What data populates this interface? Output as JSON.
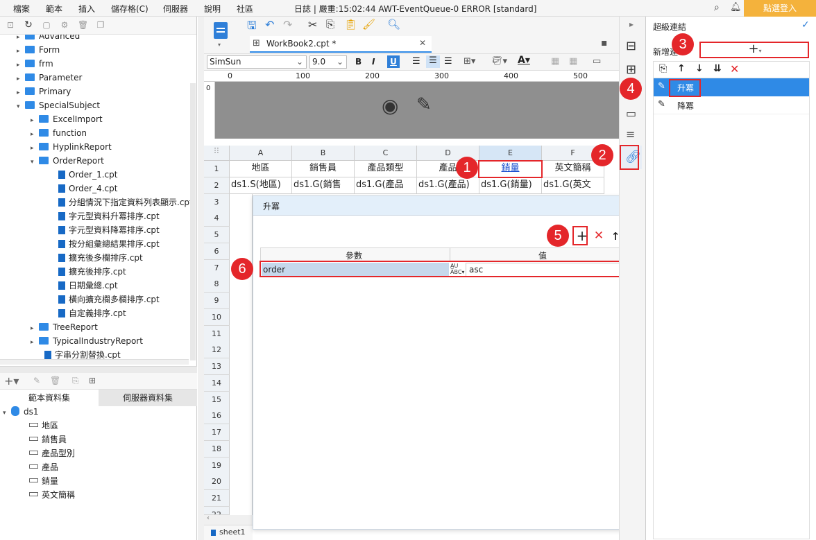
{
  "menubar": {
    "items": [
      "檔案",
      "範本",
      "插入",
      "儲存格(C)",
      "伺服器",
      "說明",
      "社區"
    ],
    "log": "日誌 | 嚴重:15:02:44 AWT-EventQueue-0 ERROR [standard]",
    "login": "點選登入"
  },
  "tree": {
    "items": [
      {
        "label": "Advanced"
      },
      {
        "label": "Form"
      },
      {
        "label": "frm"
      },
      {
        "label": "Parameter"
      },
      {
        "label": "Primary"
      },
      {
        "label": "SpecialSubject"
      },
      {
        "label": "ExcelImport"
      },
      {
        "label": "function"
      },
      {
        "label": "HyplinkReport"
      },
      {
        "label": "OrderReport"
      },
      {
        "label": "Order_1.cpt"
      },
      {
        "label": "Order_4.cpt"
      },
      {
        "label": "分組情況下指定資料列表顯示.cpt"
      },
      {
        "label": "字元型資料升冪排序.cpt"
      },
      {
        "label": "字元型資料降冪排序.cpt"
      },
      {
        "label": "按分組彙總結果排序.cpt"
      },
      {
        "label": "擴充後多欄排序.cpt"
      },
      {
        "label": "擴充後排序.cpt"
      },
      {
        "label": "日期彙總.cpt"
      },
      {
        "label": "橫向擴充欄多欄排序.cpt"
      },
      {
        "label": "自定義排序.cpt"
      },
      {
        "label": "TreeReport"
      },
      {
        "label": "TypicalIndustryReport"
      },
      {
        "label": "字串分割替換.cpt"
      }
    ]
  },
  "dataset_tabs": [
    "範本資料集",
    "伺服器資料集"
  ],
  "dataset": {
    "name": "ds1",
    "fields": [
      "地區",
      "銷售員",
      "產品型別",
      "產品",
      "銷量",
      "英文簡稱"
    ]
  },
  "editor": {
    "tab": "WorkBook2.cpt *",
    "font": "SimSun",
    "font_size": "9.0",
    "ruler": [
      "0",
      "100",
      "200",
      "300",
      "400",
      "500"
    ],
    "ruler_left": "0",
    "columns": [
      "A",
      "B",
      "C",
      "D",
      "E",
      "F"
    ],
    "rows": [
      "1",
      "2",
      "3",
      "4",
      "5",
      "6",
      "7",
      "8",
      "9",
      "10",
      "11",
      "12",
      "13",
      "14",
      "15",
      "16",
      "17",
      "18",
      "19",
      "20",
      "21",
      "22"
    ],
    "row1": [
      "地區",
      "銷售員",
      "產品類型",
      "產品",
      "銷量",
      "英文簡稱"
    ],
    "row2": [
      "ds1.S(地區)",
      "ds1.G(銷售",
      "ds1.G(產品",
      "ds1.G(產品)",
      "ds1.G(銷量)",
      "ds1.G(英文"
    ],
    "sheet": "sheet1"
  },
  "dialog": {
    "title": "升冪",
    "col_param": "參數",
    "col_value": "值",
    "param": "order",
    "value": "asc"
  },
  "right_panel": {
    "title": "超級連結",
    "new_label": "新增連",
    "items": [
      "升冪",
      "降冪"
    ]
  },
  "badges": [
    "1",
    "2",
    "3",
    "4",
    "5",
    "6"
  ],
  "colors": {
    "accent": "#e4262a",
    "selection": "#2f8ae6",
    "login": "#f4b23c"
  }
}
